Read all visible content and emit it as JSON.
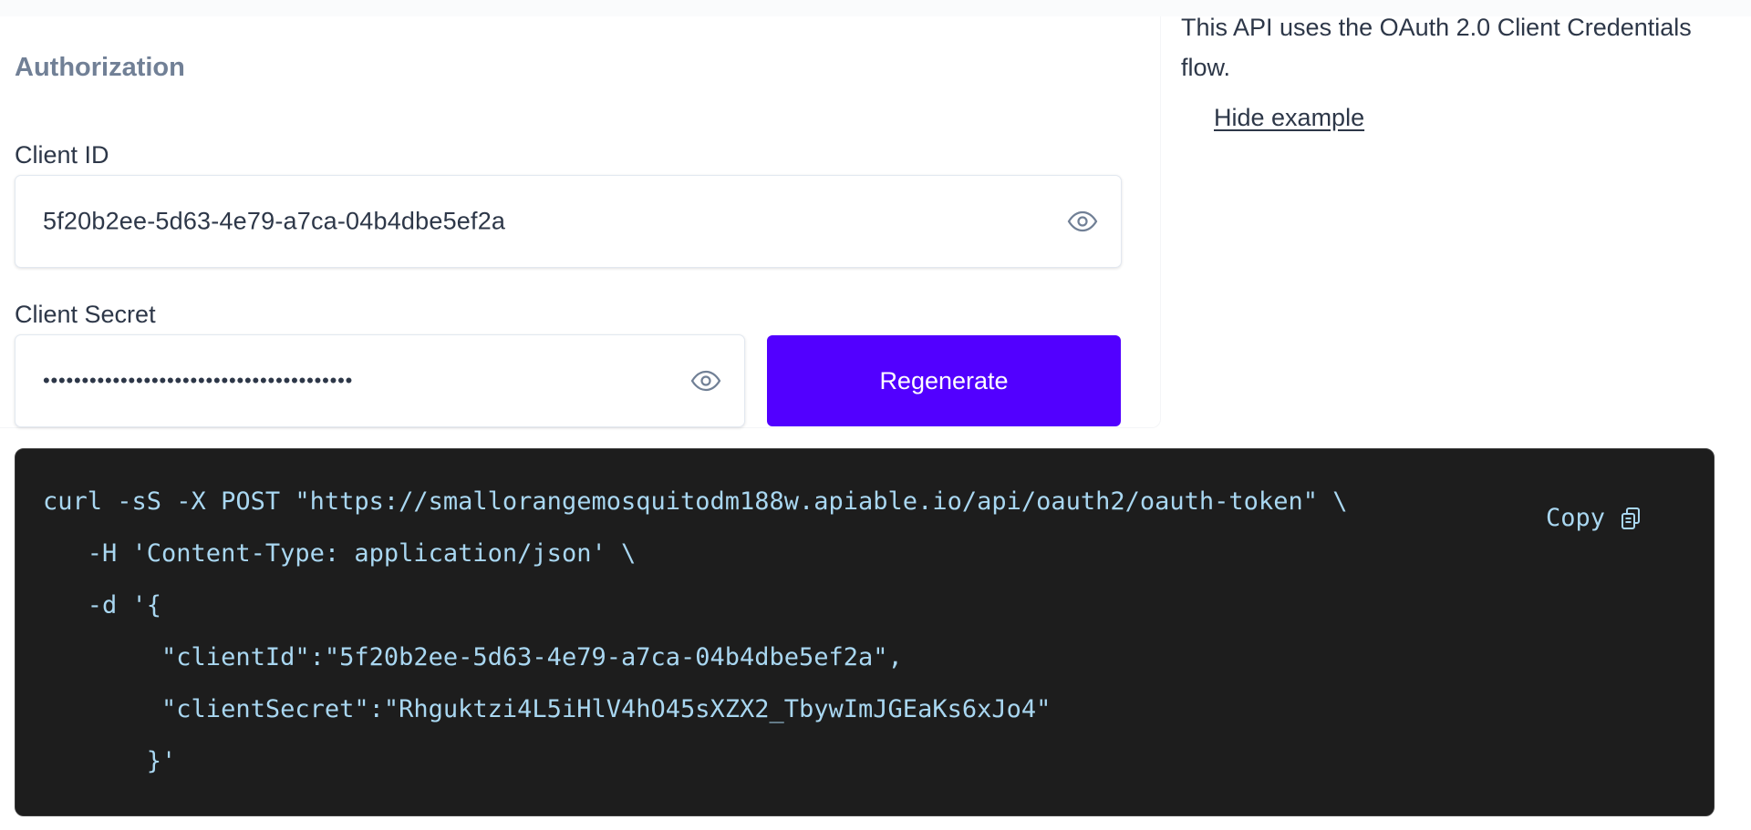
{
  "authorization": {
    "heading": "Authorization",
    "client_id": {
      "label": "Client ID",
      "value": "5f20b2ee-5d63-4e79-a7ca-04b4dbe5ef2a"
    },
    "client_secret": {
      "label": "Client Secret",
      "masked_value": "••••••••••••••••••••••••••••••••••••••••"
    },
    "regenerate_label": "Regenerate"
  },
  "info": {
    "description": "This API uses the OAuth 2.0 Client Credentials flow.",
    "toggle_example_label": "Hide example"
  },
  "code_example": {
    "lines": [
      "curl -sS -X POST \"https://smallorangemosquitodm188w.apiable.io/api/oauth2/oauth-token\" \\",
      "   -H 'Content-Type: application/json' \\",
      "   -d '{",
      "        \"clientId\":\"5f20b2ee-5d63-4e79-a7ca-04b4dbe5ef2a\",",
      "        \"clientSecret\":\"Rhguktzi4L5iHlV4hO45sXZX2_TbywImJGEaKs6xJo4\"",
      "       }'"
    ],
    "copy_label": "Copy"
  },
  "colors": {
    "accent": "#5200ff",
    "code_background": "#1d1d1d",
    "code_text": "#a9d7f1",
    "heading_muted": "#718096",
    "text": "#2d3748"
  },
  "icons": {
    "reveal": "eye-icon",
    "copy": "clipboard-icon"
  }
}
